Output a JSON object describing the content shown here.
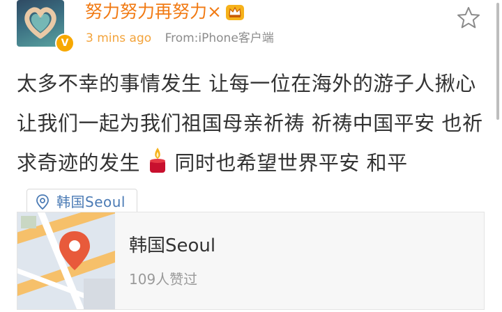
{
  "post": {
    "username": "努力努力再努力×",
    "crown_icon": "crown-icon",
    "verified_badge": "V",
    "time": "3 mins ago",
    "source": "From:iPhone客户端",
    "text": "太多不幸的事情发生 让每一位在海外的游子人揪心  让我们一起为我们祖国母亲祈祷  祈祷中国平安 也祈求奇迹的发生 ",
    "candle_icon": "candle-icon",
    "text_after_icon": " 同时也希望世界平安 和平",
    "location_chip": {
      "icon": "location-pin-icon",
      "label": "韩国Seoul"
    }
  },
  "location_card": {
    "title": "韩国Seoul",
    "likes": "109人赞过",
    "map_icon": "map-pin-icon"
  },
  "colors": {
    "username": "#f17a13",
    "time": "#f3a33a",
    "link": "#4b7bb5",
    "map_pin": "#e85a3b",
    "verified": "#f7a800"
  }
}
